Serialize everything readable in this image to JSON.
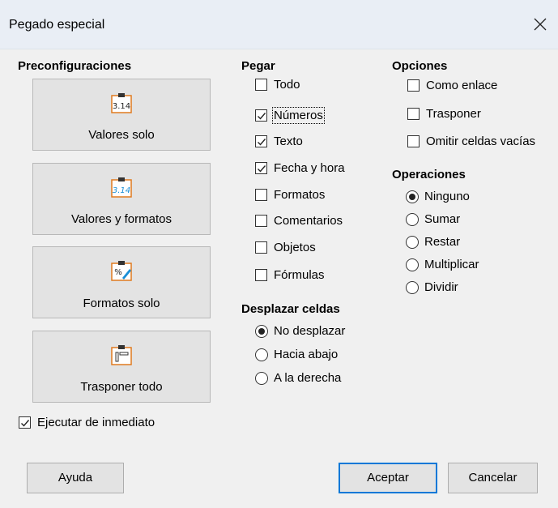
{
  "window": {
    "title": "Pegado especial"
  },
  "presets": {
    "heading": "Preconfiguraciones",
    "buttons": [
      {
        "label": "Valores solo",
        "icon": "clipboard-values-icon"
      },
      {
        "label": "Valores y formatos",
        "icon": "clipboard-values-formats-icon"
      },
      {
        "label": "Formatos solo",
        "icon": "clipboard-formats-icon"
      },
      {
        "label": "Trasponer todo",
        "icon": "clipboard-transpose-icon"
      }
    ],
    "icon_text": {
      "values": "3.14",
      "values_formats": "3.14",
      "formats": "%"
    },
    "run_immediately": {
      "label": "Ejecutar de inmediato",
      "checked": true
    }
  },
  "paste": {
    "heading": "Pegar",
    "items": [
      {
        "label": "Todo",
        "checked": false
      },
      {
        "label": "Números",
        "checked": true
      },
      {
        "label": "Texto",
        "checked": true
      },
      {
        "label": "Fecha y hora",
        "checked": true
      },
      {
        "label": "Formatos",
        "checked": false
      },
      {
        "label": "Comentarios",
        "checked": false
      },
      {
        "label": "Objetos",
        "checked": false
      },
      {
        "label": "Fórmulas",
        "checked": false
      }
    ]
  },
  "shift": {
    "heading": "Desplazar celdas",
    "items": [
      {
        "label": "No desplazar",
        "selected": true
      },
      {
        "label": "Hacia abajo",
        "selected": false
      },
      {
        "label": "A la derecha",
        "selected": false
      }
    ]
  },
  "options": {
    "heading": "Opciones",
    "items": [
      {
        "label": "Como enlace",
        "checked": false
      },
      {
        "label": "Trasponer",
        "checked": false
      },
      {
        "label": "Omitir celdas vacías",
        "checked": false
      }
    ]
  },
  "operations": {
    "heading": "Operaciones",
    "items": [
      {
        "label": "Ninguno",
        "selected": true
      },
      {
        "label": "Sumar",
        "selected": false
      },
      {
        "label": "Restar",
        "selected": false
      },
      {
        "label": "Multiplicar",
        "selected": false
      },
      {
        "label": "Dividir",
        "selected": false
      }
    ]
  },
  "footer": {
    "help": "Ayuda",
    "ok": "Aceptar",
    "cancel": "Cancelar"
  },
  "colors": {
    "accent": "#0078d7",
    "icon_orange": "#e07a1f",
    "icon_blue": "#1a8fd6"
  }
}
